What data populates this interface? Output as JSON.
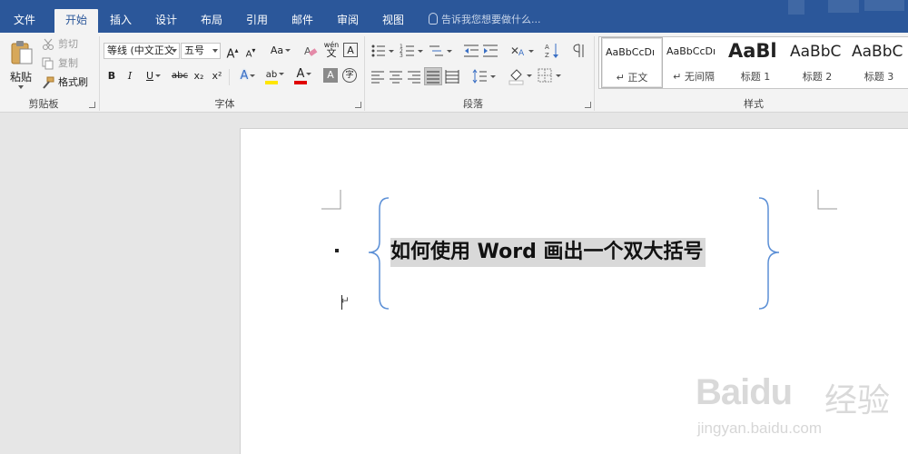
{
  "tabs": {
    "file": "文件",
    "home": "开始",
    "insert": "插入",
    "design": "设计",
    "layout": "布局",
    "references": "引用",
    "mailings": "邮件",
    "review": "审阅",
    "view": "视图"
  },
  "tell_me": "告诉我您想要做什么...",
  "clipboard": {
    "paste": "粘贴",
    "cut": "剪切",
    "copy": "复制",
    "format_painter": "格式刷",
    "label": "剪贴板"
  },
  "font": {
    "font_name": "等线 (中文正文",
    "font_size": "五号",
    "grow": "A",
    "shrink": "A",
    "case": "Aa",
    "phonetic": "wén",
    "border_char": "A",
    "bold": "B",
    "italic": "I",
    "underline": "U",
    "strikethrough": "abc",
    "subscript": "x₂",
    "superscript": "x²",
    "text_effects": "A",
    "highlight": "ab",
    "font_color": "A",
    "char_shading": "A",
    "enclose": "字",
    "label": "字体"
  },
  "paragraph": {
    "label": "段落"
  },
  "styles": {
    "label": "样式",
    "items": [
      {
        "sample": "AaBbCcDı",
        "name": "↵ 正文"
      },
      {
        "sample": "AaBbCcDı",
        "name": "↵ 无间隔"
      },
      {
        "sample": "AaBl",
        "name": "标题 1"
      },
      {
        "sample": "AaBbC",
        "name": "标题 2"
      },
      {
        "sample": "AaBbC",
        "name": "标题 3"
      }
    ]
  },
  "document": {
    "text": "如何使用 Word 画出一个双大括号",
    "paragraph_mark": "↵"
  },
  "watermark": {
    "logo": "Baidu",
    "cn": "经验",
    "url": "jingyan.baidu.com"
  },
  "colors": {
    "ribbon_blue": "#2b579a",
    "highlight_yellow": "#ffe600",
    "font_red": "#e00000",
    "brace_blue": "#5b8fd6"
  }
}
